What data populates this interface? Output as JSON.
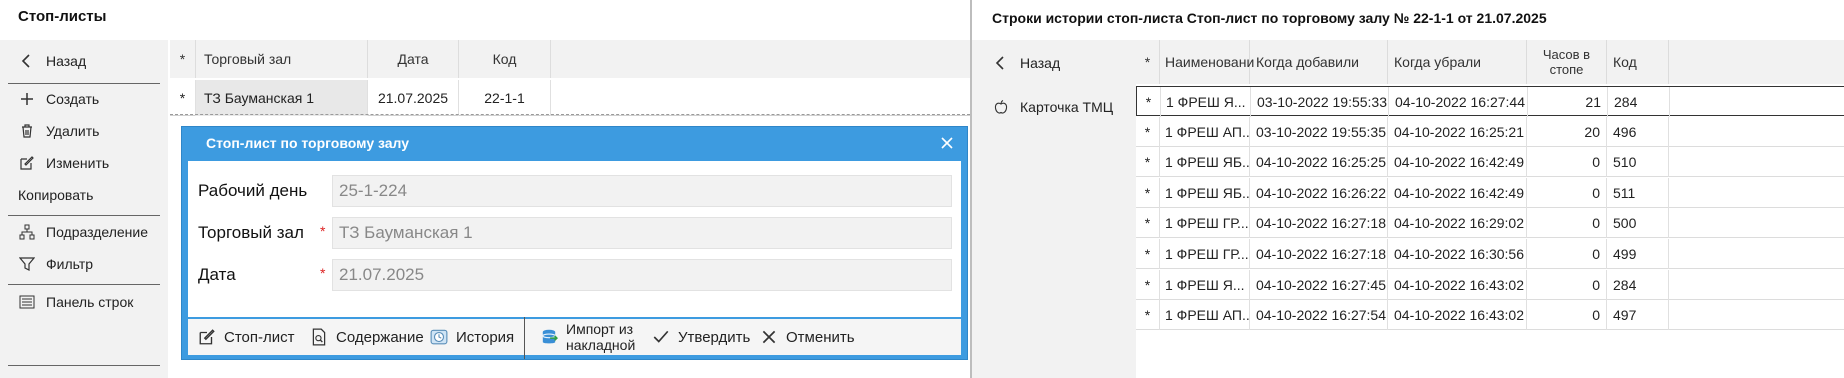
{
  "left_window": {
    "title": "Стоп-листы",
    "sidebar": {
      "back": "Назад",
      "create": "Создать",
      "delete": "Удалить",
      "edit": "Изменить",
      "copy": "Копировать",
      "division": "Подразделение",
      "filter": "Фильтр",
      "rows_panel": "Панель строк"
    },
    "grid": {
      "headers": {
        "star": "*",
        "hall": "Торговый зал",
        "date": "Дата",
        "code": "Код"
      },
      "rows": [
        {
          "star": "*",
          "hall": "ТЗ Бауманская 1",
          "date": "21.07.2025",
          "code": "22-1-1"
        }
      ]
    }
  },
  "dialog": {
    "title": "Стоп-лист по торговому залу",
    "fields": {
      "workday_label": "Рабочий день",
      "workday_value": "25-1-224",
      "hall_label": "Торговый зал",
      "hall_value": "ТЗ Бауманская 1",
      "date_label": "Дата",
      "date_value": "21.07.2025",
      "required_mark": "*"
    },
    "footer": {
      "stoplist": "Стоп-лист",
      "content": "Содержание",
      "history": "История",
      "import_line1": "Импорт из",
      "import_line2": "накладной",
      "approve": "Утвердить",
      "cancel": "Отменить"
    }
  },
  "right_window": {
    "title": "Строки истории стоп-листа  Стоп-лист по торговому залу № 22-1-1 от 21.07.2025",
    "sidebar": {
      "back": "Назад",
      "card": "Карточка ТМЦ"
    },
    "grid": {
      "headers": {
        "star": "*",
        "name": "Наименовани",
        "added": "Когда добавили",
        "removed": "Когда убрали",
        "hours_line1": "Часов в",
        "hours_line2": "стопе",
        "code": "Код"
      },
      "rows": [
        {
          "star": "*",
          "name": "1 ФРЕШ  Я...",
          "added": "03-10-2022 19:55:33",
          "removed": "04-10-2022 16:27:44",
          "hours": "21",
          "code": "284"
        },
        {
          "star": "*",
          "name": "1 ФРЕШ АП...",
          "added": "03-10-2022 19:55:35",
          "removed": "04-10-2022 16:25:21",
          "hours": "20",
          "code": "496"
        },
        {
          "star": "*",
          "name": "1 ФРЕШ ЯБ...",
          "added": "04-10-2022 16:25:25",
          "removed": "04-10-2022 16:42:49",
          "hours": "0",
          "code": "510"
        },
        {
          "star": "*",
          "name": "1 ФРЕШ ЯБ...",
          "added": "04-10-2022 16:26:22",
          "removed": "04-10-2022 16:42:49",
          "hours": "0",
          "code": "511"
        },
        {
          "star": "*",
          "name": "1 ФРЕШ ГР...",
          "added": "04-10-2022 16:27:18",
          "removed": "04-10-2022 16:29:02",
          "hours": "0",
          "code": "500"
        },
        {
          "star": "*",
          "name": "1 ФРЕШ ГР...",
          "added": "04-10-2022 16:27:18",
          "removed": "04-10-2022 16:30:56",
          "hours": "0",
          "code": "499"
        },
        {
          "star": "*",
          "name": "1 ФРЕШ  Я...",
          "added": "04-10-2022 16:27:45",
          "removed": "04-10-2022 16:43:02",
          "hours": "0",
          "code": "284"
        },
        {
          "star": "*",
          "name": "1 ФРЕШ АП...",
          "added": "04-10-2022 16:27:54",
          "removed": "04-10-2022 16:43:02",
          "hours": "0",
          "code": "497"
        }
      ]
    }
  }
}
